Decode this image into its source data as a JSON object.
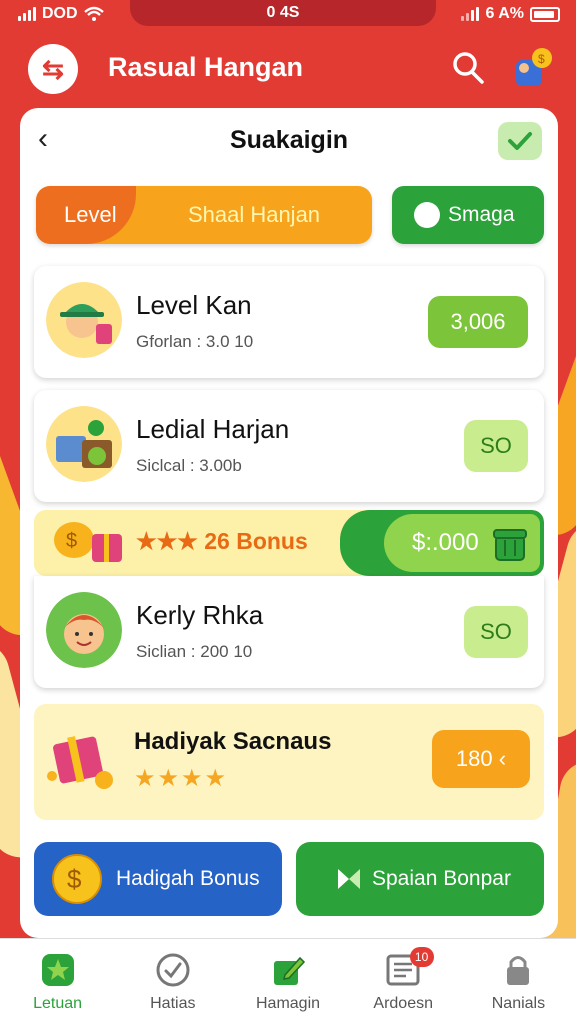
{
  "status_bar": {
    "carrier": "DOD",
    "time": "0 4S",
    "battery_text": "6 A%"
  },
  "app_bar": {
    "title": "Rasual Hangan",
    "logo_glyph": "⇆"
  },
  "card": {
    "title": "Suakaigin",
    "back_glyph": "‹"
  },
  "tabs": {
    "level_label": "Level",
    "level_sub": "Shaal Hanjan",
    "smaga_label": "Smaga"
  },
  "items": [
    {
      "name": "Level Kan",
      "sub": "Gforlan : 3.0 10",
      "value": "3,006"
    },
    {
      "name": "Ledial Harjan",
      "sub": "Siclcal : 3.00b",
      "value": "SO"
    },
    {
      "name": "Kerly Rhka",
      "sub": "Siclian : 200 10",
      "value": "SO"
    }
  ],
  "bonus_strip": {
    "stars": "★★★",
    "label": "26 Bonus",
    "amount": "$:.000"
  },
  "hadiyak": {
    "name": "Hadiyak Sacnaus",
    "stars": "★★★★",
    "value": "180 ‹"
  },
  "buttons": {
    "bonus_label": "Hadigah Bonus",
    "spaian_label": "Spaian Bonpar"
  },
  "bottom_nav": [
    {
      "label": "Letuan",
      "icon": "star-icon"
    },
    {
      "label": "Hatias",
      "icon": "check-circle-icon"
    },
    {
      "label": "Hamagin",
      "icon": "edit-icon"
    },
    {
      "label": "Ardoesn",
      "icon": "document-icon",
      "badge": "10"
    },
    {
      "label": "Nanials",
      "icon": "lock-icon"
    }
  ],
  "colors": {
    "brand_red": "#e23b34",
    "green": "#2ca23a",
    "orange": "#f7a31c",
    "blue": "#2563c7"
  }
}
